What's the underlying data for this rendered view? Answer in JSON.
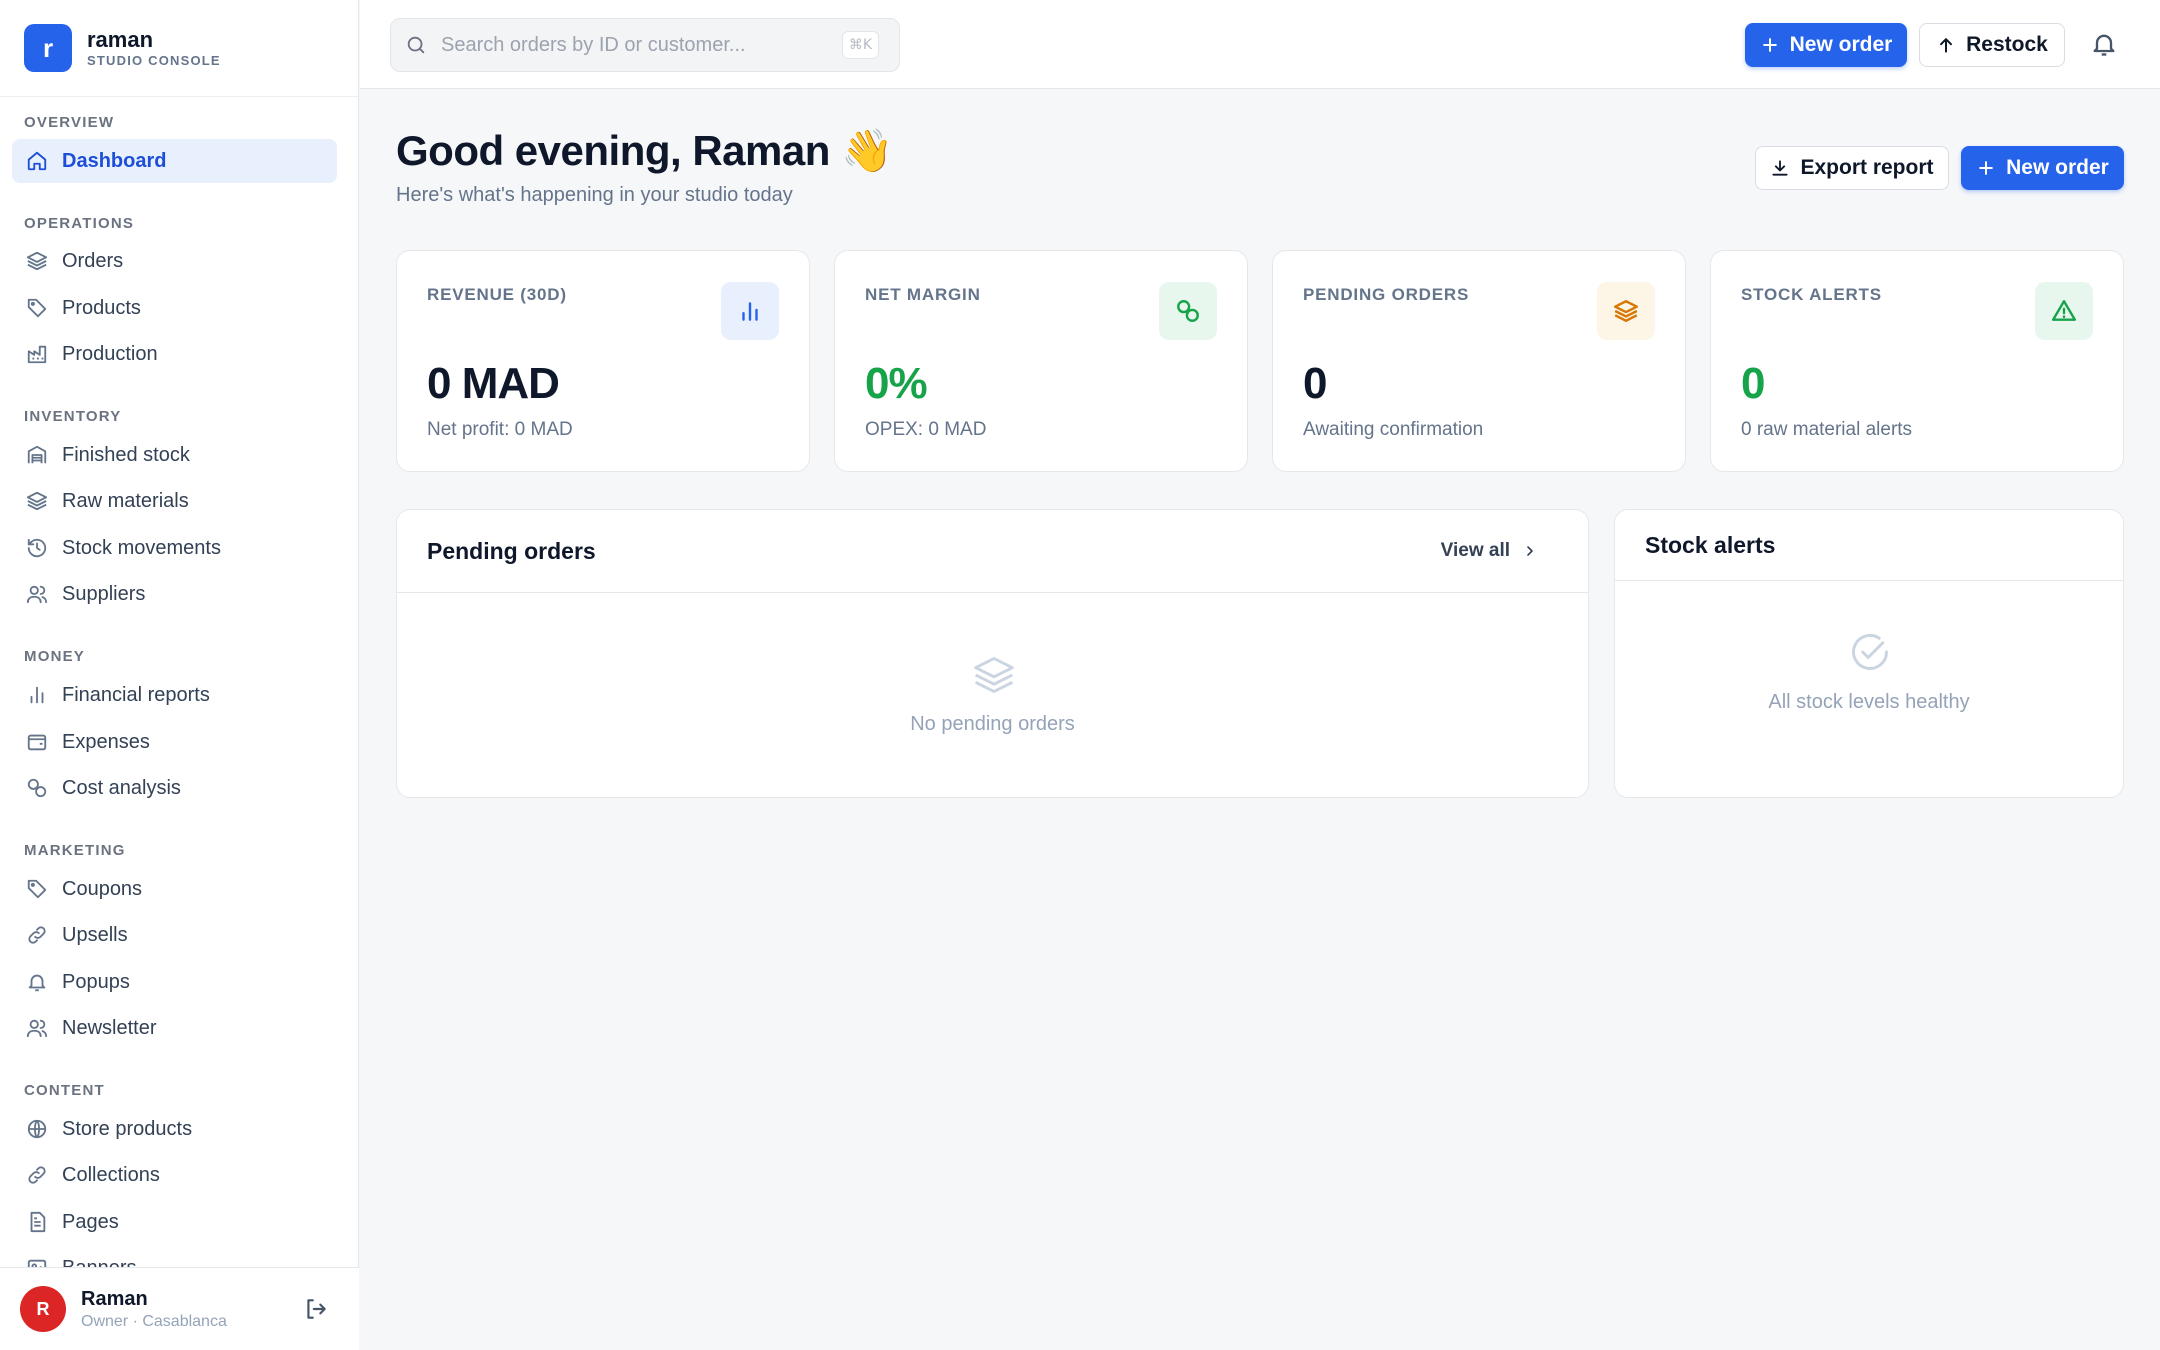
{
  "brand": {
    "logo_letter": "r",
    "name": "raman",
    "subtitle": "STUDIO CONSOLE"
  },
  "sidebar": {
    "sections": [
      {
        "title": "OVERVIEW",
        "items": [
          {
            "label": "Dashboard",
            "icon": "home-icon",
            "active": true
          }
        ]
      },
      {
        "title": "OPERATIONS",
        "items": [
          {
            "label": "Orders",
            "icon": "layers-icon"
          },
          {
            "label": "Products",
            "icon": "tag-icon"
          },
          {
            "label": "Production",
            "icon": "factory-icon"
          }
        ]
      },
      {
        "title": "INVENTORY",
        "items": [
          {
            "label": "Finished stock",
            "icon": "warehouse-icon"
          },
          {
            "label": "Raw materials",
            "icon": "layers-icon"
          },
          {
            "label": "Stock movements",
            "icon": "history-icon"
          },
          {
            "label": "Suppliers",
            "icon": "users-icon"
          }
        ]
      },
      {
        "title": "MONEY",
        "items": [
          {
            "label": "Financial reports",
            "icon": "bar-chart-icon"
          },
          {
            "label": "Expenses",
            "icon": "wallet-icon"
          },
          {
            "label": "Cost analysis",
            "icon": "coins-icon"
          }
        ]
      },
      {
        "title": "MARKETING",
        "items": [
          {
            "label": "Coupons",
            "icon": "tag-icon"
          },
          {
            "label": "Upsells",
            "icon": "link-icon"
          },
          {
            "label": "Popups",
            "icon": "bell-icon"
          },
          {
            "label": "Newsletter",
            "icon": "users-icon"
          }
        ]
      },
      {
        "title": "CONTENT",
        "items": [
          {
            "label": "Store products",
            "icon": "globe-icon"
          },
          {
            "label": "Collections",
            "icon": "link-icon"
          },
          {
            "label": "Pages",
            "icon": "file-icon"
          },
          {
            "label": "Banners",
            "icon": "image-icon"
          }
        ]
      }
    ]
  },
  "user": {
    "initial": "R",
    "name": "Raman",
    "role": "Owner · Casablanca"
  },
  "search": {
    "placeholder": "Search orders by ID or customer...",
    "shortcut": "⌘K"
  },
  "topbar": {
    "new_order_label": "New order",
    "restock_label": "Restock"
  },
  "header": {
    "greeting": "Good evening, Raman 👋",
    "subtitle": "Here's what's happening in your studio today",
    "export_label": "Export report",
    "new_order_label": "New order"
  },
  "stats": [
    {
      "label": "REVENUE (30D)",
      "value": "0 MAD",
      "hint": "Net profit: 0 MAD",
      "icon": "bar-chart-icon",
      "value_color": "#0f172a",
      "icon_bg": "#e8effd",
      "icon_color": "#2563eb"
    },
    {
      "label": "NET MARGIN",
      "value": "0%",
      "hint": "OPEX: 0 MAD",
      "icon": "coins-icon",
      "value_color": "#16a34a",
      "icon_bg": "#e7f7ee",
      "icon_color": "#16a34a"
    },
    {
      "label": "PENDING ORDERS",
      "value": "0",
      "hint": "Awaiting confirmation",
      "icon": "layers-icon",
      "value_color": "#0f172a",
      "icon_bg": "#fdf5e6",
      "icon_color": "#d97706"
    },
    {
      "label": "STOCK ALERTS",
      "value": "0",
      "hint": "0 raw material alerts",
      "icon": "alert-triangle-icon",
      "value_color": "#16a34a",
      "icon_bg": "#e7f7ee",
      "icon_color": "#16a34a"
    }
  ],
  "pending_orders": {
    "title": "Pending orders",
    "view_all": "View all",
    "empty_text": "No pending orders"
  },
  "stock_alerts": {
    "title": "Stock alerts",
    "empty_text": "All stock levels healthy"
  },
  "colors": {
    "accent": "#2563eb",
    "success": "#16a34a",
    "warning": "#d97706",
    "danger": "#dc2626"
  }
}
